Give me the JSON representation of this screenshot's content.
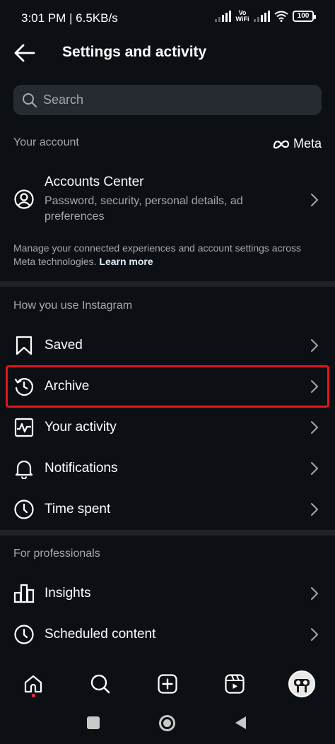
{
  "status": {
    "time_speed": "3:01 PM | 6.5KB/s",
    "vowifi": "Vo WiFi",
    "battery": "100"
  },
  "header": {
    "title": "Settings and activity"
  },
  "search": {
    "placeholder": "Search"
  },
  "your_account": {
    "section_label": "Your account",
    "meta_label": "Meta",
    "accounts_center": {
      "title": "Accounts Center",
      "subtitle": "Password, security, personal details, ad preferences"
    },
    "manage_text": "Manage your connected experiences and account settings across Meta technologies.",
    "learn_more": "Learn more"
  },
  "how_you_use": {
    "section_label": "How you use Instagram",
    "items": [
      {
        "label": "Saved",
        "icon": "bookmark-icon"
      },
      {
        "label": "Archive",
        "icon": "archive-clock-icon"
      },
      {
        "label": "Your activity",
        "icon": "activity-icon"
      },
      {
        "label": "Notifications",
        "icon": "bell-icon"
      },
      {
        "label": "Time spent",
        "icon": "clock-icon"
      }
    ]
  },
  "for_professionals": {
    "section_label": "For professionals",
    "items": [
      {
        "label": "Insights",
        "icon": "bar-chart-icon"
      },
      {
        "label": "Scheduled content",
        "icon": "clock-icon"
      }
    ]
  },
  "colors": {
    "background": "#0c0f14",
    "highlight": "#e01818",
    "notification_dot": "#ff3040"
  }
}
